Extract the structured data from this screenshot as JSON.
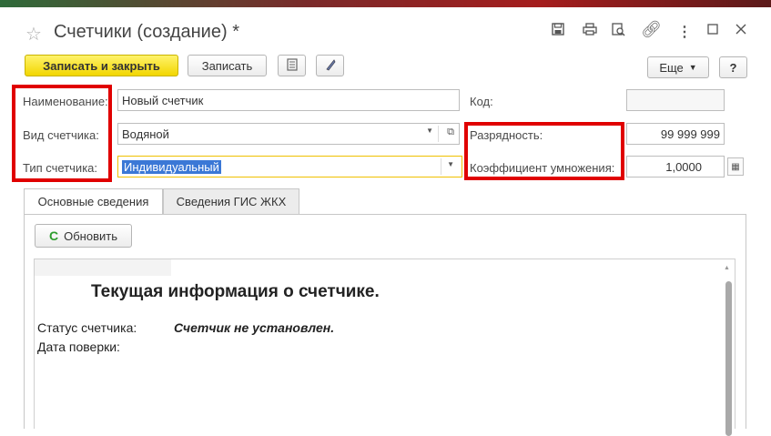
{
  "window": {
    "title": "Счетчики (создание) *",
    "icons": [
      "star-icon",
      "save-icon",
      "print-icon",
      "preview-icon",
      "link-icon",
      "more-vert-icon",
      "maximize-icon",
      "close-icon"
    ]
  },
  "toolbar": {
    "save_close": "Записать и закрыть",
    "save": "Записать",
    "more": "Еще",
    "help": "?"
  },
  "form": {
    "name_label": "Наименование:",
    "name_value": "Новый счетчик",
    "code_label": "Код:",
    "code_value": "",
    "type_label": "Вид счетчика:",
    "type_value": "Водяной",
    "digits_label": "Разрядность:",
    "digits_value": "99 999 999",
    "kind_label": "Тип счетчика:",
    "kind_value": "Индивидуальный",
    "coef_label": "Коэффициент умножения:",
    "coef_value": "1,0000"
  },
  "tabs": [
    {
      "label": "Основные сведения"
    },
    {
      "label": "Сведения ГИС ЖКХ"
    }
  ],
  "panel": {
    "refresh_label": "Обновить",
    "heading": "Текущая информация о счетчике.",
    "status_label": "Статус счетчика:",
    "status_value": "Счетчик не установлен.",
    "check_label": "Дата поверки:"
  },
  "colors": {
    "primary_button": "#f2d600",
    "highlight": "#e00000",
    "selection": "#3b78d6"
  }
}
